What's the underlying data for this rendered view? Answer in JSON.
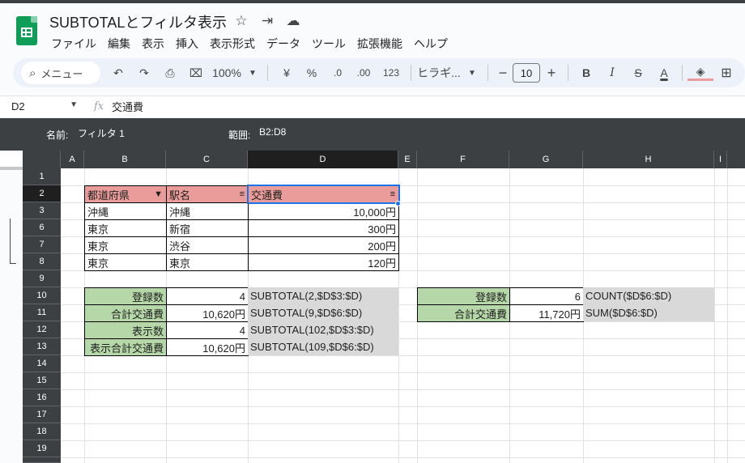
{
  "app": {
    "title": "SUBTOTALとフィルタ表示",
    "menu": [
      "ファイル",
      "編集",
      "表示",
      "挿入",
      "表示形式",
      "データ",
      "ツール",
      "拡張機能",
      "ヘルプ"
    ]
  },
  "toolbar": {
    "search_placeholder": "メニュー",
    "zoom": "100%",
    "currency": "¥",
    "percent": "%",
    "dec_decrease": ".0",
    "dec_increase": ".00",
    "number_format": "123",
    "font": "ヒラギ...",
    "font_size": "10",
    "bold": "B",
    "italic": "I",
    "strike": "S",
    "text_color": "A"
  },
  "formula_bar": {
    "name_box": "D2",
    "fx": "fx",
    "content": "交通費"
  },
  "filter_view": {
    "name_label": "名前:",
    "name_value": "フィルタ 1",
    "range_label": "範囲:",
    "range_value": "B2:D8"
  },
  "columns": [
    "A",
    "B",
    "C",
    "D",
    "E",
    "F",
    "G",
    "H",
    "I"
  ],
  "rows": [
    "1",
    "2",
    "3",
    "6",
    "7",
    "8",
    "9",
    "10",
    "11",
    "12",
    "13",
    "14",
    "15",
    "16",
    "17",
    "18",
    "19"
  ],
  "table": {
    "headers": [
      "都道府県",
      "駅名",
      "交通費"
    ],
    "data": [
      [
        "沖縄",
        "沖縄",
        "10,000円"
      ],
      [
        "東京",
        "新宿",
        "300円"
      ],
      [
        "東京",
        "渋谷",
        "200円"
      ],
      [
        "東京",
        "東京",
        "120円"
      ]
    ]
  },
  "summary_left": [
    {
      "label": "登録数",
      "value": "4",
      "formula": "SUBTOTAL(2,$D$3:$D)"
    },
    {
      "label": "合計交通費",
      "value": "10,620円",
      "formula": "SUBTOTAL(9,$D$6:$D)"
    },
    {
      "label": "表示数",
      "value": "4",
      "formula": "SUBTOTAL(102,$D$3:$D)"
    },
    {
      "label": "表示合計交通費",
      "value": "10,620円",
      "formula": "SUBTOTAL(109,$D$6:$D)"
    }
  ],
  "summary_right": [
    {
      "label": "登録数",
      "value": "6",
      "formula": "COUNT($D$6:$D)"
    },
    {
      "label": "合計交通費",
      "value": "11,720円",
      "formula": "SUM($D$6:$D)"
    }
  ],
  "colors": {
    "header_fill": "#e99c99",
    "label_fill": "#b6d7a8",
    "formula_fill": "#d9d9d9",
    "selection": "#1a73e8"
  }
}
